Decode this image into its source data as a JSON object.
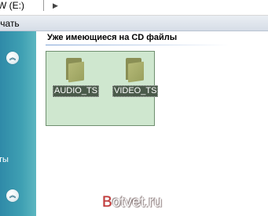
{
  "address_bar": {
    "path_text": "W (E:)",
    "arrow_icon": "chevron-right-icon"
  },
  "toolbar": {
    "print_label": "ечать"
  },
  "left_pane": {
    "partial_caption": "ты",
    "collapse_icon": "chevron-up-icon"
  },
  "main": {
    "group_title": "Уже имеющиеся на CD файлы",
    "files": [
      {
        "name": "AUDIO_TS",
        "icon": "folder-icon"
      },
      {
        "name": "VIDEO_TS",
        "icon": "folder-icon"
      }
    ]
  },
  "watermark": {
    "first_letter": "B",
    "rest": "otvet.ru"
  }
}
